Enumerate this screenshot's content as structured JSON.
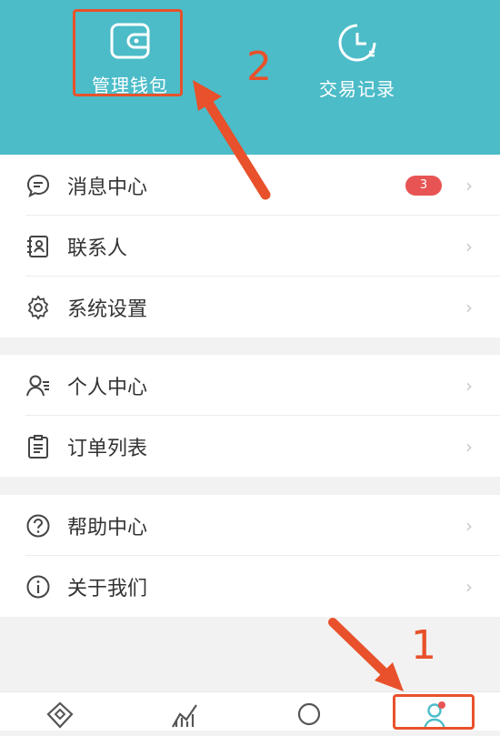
{
  "header": {
    "wallet_label": "管理钱包",
    "records_label": "交易记录",
    "bg_color": "#4cbcc8"
  },
  "section1": [
    {
      "label": "消息中心",
      "icon": "chat-bubble-icon",
      "badge": "3"
    },
    {
      "label": "联系人",
      "icon": "contacts-card-icon"
    },
    {
      "label": "系统设置",
      "icon": "gear-icon"
    }
  ],
  "section2": [
    {
      "label": "个人中心",
      "icon": "person-icon"
    },
    {
      "label": "订单列表",
      "icon": "clipboard-list-icon"
    }
  ],
  "section3": [
    {
      "label": "帮助中心",
      "icon": "question-circle-icon"
    },
    {
      "label": "关于我们",
      "icon": "info-circle-icon"
    }
  ],
  "tabbar": {
    "tabs": [
      "home-diamond-icon",
      "market-chart-icon",
      "discover-circle-icon",
      "profile-person-icon"
    ],
    "active_color": "#4cbcc8"
  },
  "annotations": {
    "step1": "1",
    "step2": "2",
    "color": "#e8512b"
  }
}
